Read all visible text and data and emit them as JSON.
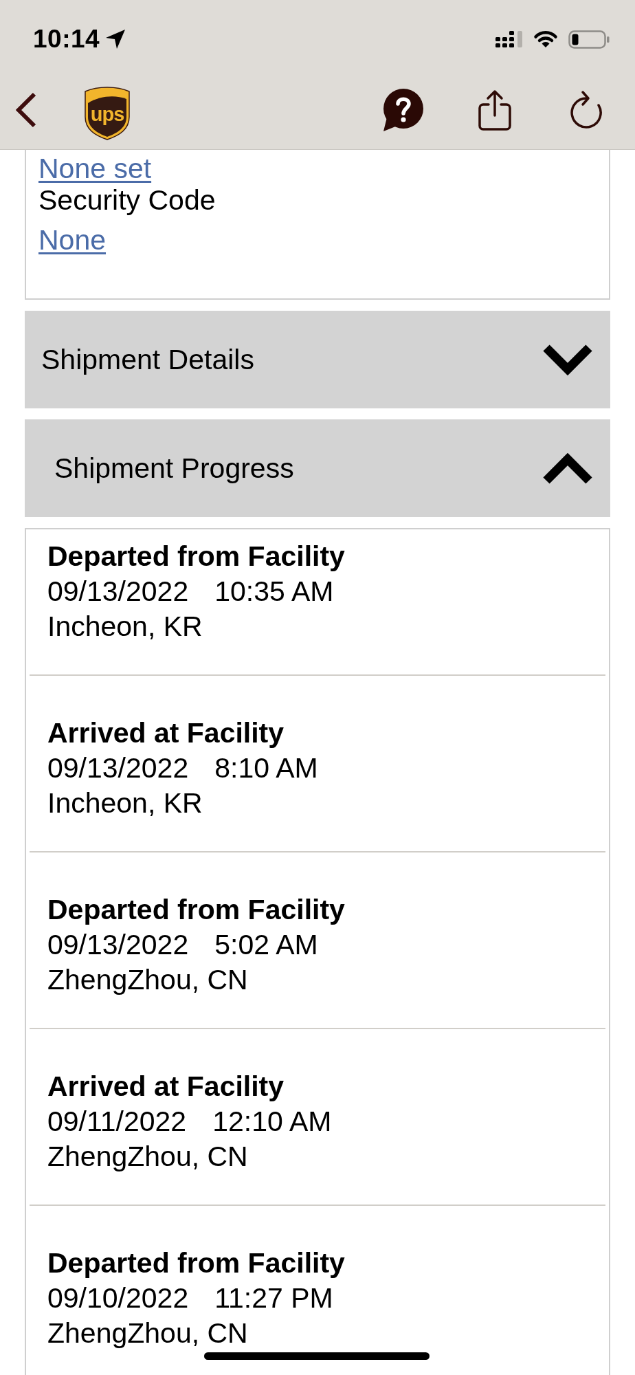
{
  "status_bar": {
    "time": "10:14"
  },
  "nav_bar": {
    "logo_text": "ups"
  },
  "security_card": {
    "fields": [
      {
        "kind": "link",
        "text": "None set"
      },
      {
        "kind": "label",
        "text": "Security Code"
      },
      {
        "kind": "link",
        "text": "None"
      }
    ]
  },
  "sections": [
    {
      "title": "Shipment Details",
      "expanded": false
    },
    {
      "title": "Shipment Progress",
      "expanded": true
    }
  ],
  "progress": [
    {
      "status": "Departed from Facility",
      "date": "09/13/2022",
      "time": "10:35 AM",
      "location": "Incheon, KR"
    },
    {
      "status": "Arrived at Facility",
      "date": "09/13/2022",
      "time": "8:10 AM",
      "location": "Incheon, KR"
    },
    {
      "status": "Departed from Facility",
      "date": "09/13/2022",
      "time": "5:02 AM",
      "location": "ZhengZhou, CN"
    },
    {
      "status": "Arrived at Facility",
      "date": "09/11/2022",
      "time": "12:10 AM",
      "location": "ZhengZhou, CN"
    },
    {
      "status": "Departed from Facility",
      "date": "09/10/2022",
      "time": "11:27 PM",
      "location": "ZhengZhou, CN"
    }
  ]
}
